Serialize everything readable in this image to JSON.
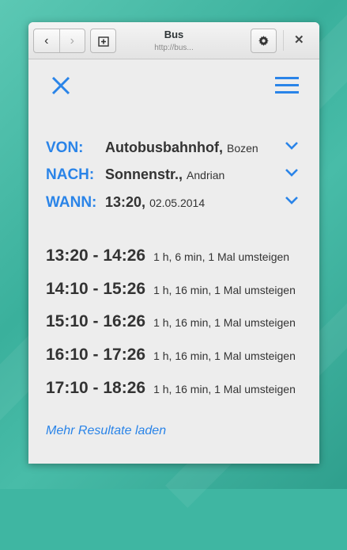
{
  "window": {
    "title": "Bus",
    "url": "http://bus...",
    "back_label": "‹",
    "forward_label": "›",
    "close_label": "✕"
  },
  "query": {
    "from_label": "VON:",
    "from_main": "Autobusbahnhof,",
    "from_sub": "Bozen",
    "to_label": "NACH:",
    "to_main": "Sonnenstr.,",
    "to_sub": "Andrian",
    "when_label": "WANN:",
    "when_time": "13:20,",
    "when_date": "02.05.2014"
  },
  "trips": [
    {
      "time": "13:20 - 14:26",
      "info": "1 h, 6 min, 1 Mal umsteigen"
    },
    {
      "time": "14:10 - 15:26",
      "info": "1 h, 16 min, 1 Mal umsteigen"
    },
    {
      "time": "15:10 - 16:26",
      "info": "1 h, 16 min, 1 Mal umsteigen"
    },
    {
      "time": "16:10 - 17:26",
      "info": "1 h, 16 min, 1 Mal umsteigen"
    },
    {
      "time": "17:10 - 18:26",
      "info": "1 h, 16 min, 1 Mal umsteigen"
    }
  ],
  "more_results": "Mehr Resultate laden",
  "colors": {
    "accent": "#2a84e8",
    "background": "#3fb6a2"
  }
}
